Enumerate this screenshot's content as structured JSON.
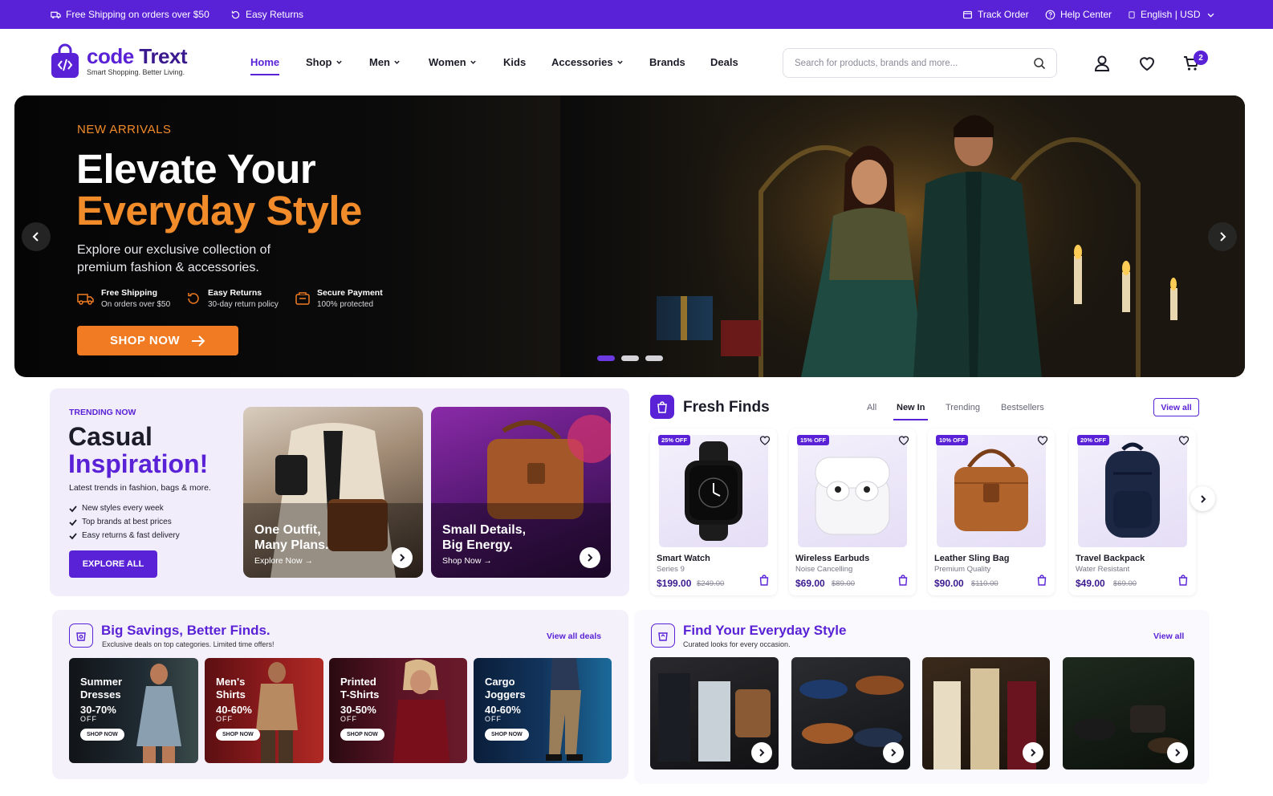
{
  "topbar": {
    "shipping": "Free Shipping on orders over $50",
    "returns": "Easy Returns",
    "track": "Track Order",
    "help": "Help Center",
    "locale": "English | USD"
  },
  "brand": {
    "name_code": "code",
    "name_trext": " Trext",
    "tagline": "Smart Shopping. Better Living."
  },
  "nav": {
    "items": [
      {
        "label": "Home",
        "active": true,
        "dropdown": false
      },
      {
        "label": "Shop",
        "dropdown": true
      },
      {
        "label": "Men",
        "dropdown": true
      },
      {
        "label": "Women",
        "dropdown": true
      },
      {
        "label": "Kids",
        "dropdown": false
      },
      {
        "label": "Accessories",
        "dropdown": true
      },
      {
        "label": "Brands",
        "dropdown": false
      },
      {
        "label": "Deals",
        "dropdown": false
      }
    ]
  },
  "search": {
    "placeholder": "Search for products, brands and more..."
  },
  "cart": {
    "count": "2"
  },
  "hero": {
    "eyebrow": "NEW ARRIVALS",
    "title_line1": "Elevate Your",
    "title_line2": "Everyday Style",
    "subtitle": "Explore our exclusive collection of premium fashion & accessories.",
    "features": [
      {
        "title": "Free Shipping",
        "sub": "On orders over $50",
        "icon": "truck-icon"
      },
      {
        "title": "Easy Returns",
        "sub": "30-day return policy",
        "icon": "returns-icon"
      },
      {
        "title": "Secure Payment",
        "sub": "100% protected",
        "icon": "payment-icon"
      }
    ],
    "cta": "SHOP NOW",
    "slides": 3,
    "active_slide": 1
  },
  "trending": {
    "eyebrow": "TRENDING NOW",
    "title_line1": "Casual",
    "title_line2": "Inspiration!",
    "desc": "Latest trends in fashion, bags & more.",
    "checks": [
      "New styles every week",
      "Top brands at best prices",
      "Easy returns & fast delivery"
    ],
    "cta": "EXPLORE ALL",
    "cards": [
      {
        "title": "One Outfit,\nMany Plans.",
        "link": "Explore Now"
      },
      {
        "title": "Small Details,\nBig Energy.",
        "link": "Shop Now"
      }
    ]
  },
  "fresh": {
    "title": "Fresh Finds",
    "tabs": [
      "All",
      "New In",
      "Trending",
      "Bestsellers"
    ],
    "active_tab": "New In",
    "view_all": "View all",
    "products": [
      {
        "discount": "25% OFF",
        "name": "Smart Watch",
        "sub": "Series 9",
        "price": "$199.00",
        "old": "$249.00"
      },
      {
        "discount": "15% OFF",
        "name": "Wireless Earbuds",
        "sub": "Noise Cancelling",
        "price": "$69.00",
        "old": "$89.00"
      },
      {
        "discount": "10% OFF",
        "name": "Leather Sling Bag",
        "sub": "Premium Quality",
        "price": "$90.00",
        "old": "$110.00"
      },
      {
        "discount": "20% OFF",
        "name": "Travel Backpack",
        "sub": "Water Resistant",
        "price": "$49.00",
        "old": "$69.00"
      }
    ]
  },
  "savings": {
    "title": "Big Savings, Better Finds.",
    "sub": "Exclusive deals on top categories. Limited time offers!",
    "link": "View all deals",
    "deals": [
      {
        "name": "Summer\nDresses",
        "pct": "30-70%",
        "off": "OFF",
        "cta": "SHOP NOW"
      },
      {
        "name": "Men's\nShirts",
        "pct": "40-60%",
        "off": "OFF",
        "cta": "SHOP NOW"
      },
      {
        "name": "Printed\nT-Shirts",
        "pct": "30-50%",
        "off": "OFF",
        "cta": "SHOP NOW"
      },
      {
        "name": "Cargo\nJoggers",
        "pct": "40-60%",
        "off": "OFF",
        "cta": "SHOP NOW"
      }
    ]
  },
  "style": {
    "title": "Find Your Everyday Style",
    "sub": "Curated looks for every occasion.",
    "link": "View all"
  },
  "colors": {
    "accent": "#5a22d6",
    "orange": "#f07b22"
  }
}
